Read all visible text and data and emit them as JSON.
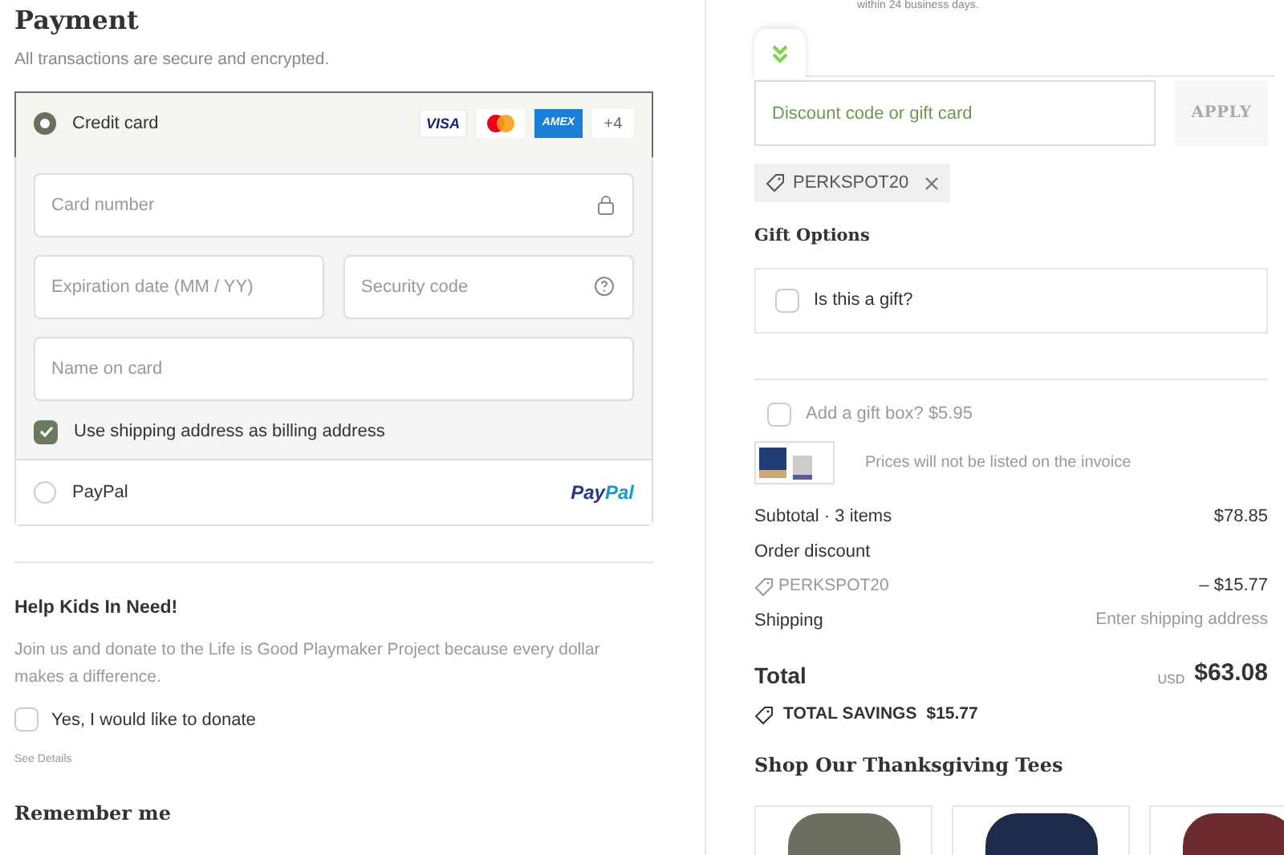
{
  "payment": {
    "title": "Payment",
    "subtitle": "All transactions are secure and encrypted.",
    "methods": [
      {
        "kind": "card",
        "label": "Credit card",
        "selected": true,
        "brands": [
          {
            "kind": "visa",
            "text": "VISA"
          },
          {
            "kind": "mastercard"
          },
          {
            "kind": "amex",
            "text": "AMEX"
          },
          {
            "kind": "more",
            "text": "+4"
          }
        ]
      },
      {
        "kind": "paypal",
        "label": "PayPal",
        "selected": false,
        "logo": [
          "Pay",
          "Pal"
        ]
      }
    ],
    "fields": {
      "card_number": {
        "placeholder": "Card number"
      },
      "expiry": {
        "placeholder": "Expiration date (MM / YY)"
      },
      "security": {
        "placeholder": "Security code"
      },
      "name": {
        "placeholder": "Name on card"
      }
    },
    "billing_same": {
      "label": "Use shipping address as billing address",
      "checked": true
    }
  },
  "donate": {
    "title": "Help Kids In Need!",
    "text": "Join us and donate to the Life is Good Playmaker Project because every dollar makes a difference.",
    "option": {
      "label": "Yes, I would like to donate",
      "checked": false
    },
    "link": "See Details"
  },
  "remember": {
    "title": "Remember me"
  },
  "summary": {
    "note": "within 24 business days.",
    "discount": {
      "placeholder": "Discount code or gift card",
      "button": "APPLY",
      "code": "PERKSPOT20"
    },
    "gift": {
      "title": "Gift Options",
      "option": {
        "label": "Is this a gift?",
        "checked": false
      },
      "box": {
        "label": "Add a gift box? $5.95",
        "checked": false
      },
      "note": "Prices will not be listed on the invoice"
    },
    "lines": [
      {
        "kind": "plain",
        "label": "Subtotal · 3 items",
        "value": "$78.85"
      },
      {
        "kind": "heading",
        "label": "Order discount"
      },
      {
        "kind": "code",
        "label": "PERKSPOT20",
        "value": "– $15.77"
      },
      {
        "kind": "muted",
        "label": "Shipping",
        "value": "Enter shipping address"
      }
    ],
    "total": {
      "label": "Total",
      "currency": "USD",
      "value": "$63.08"
    },
    "savings": {
      "label": "TOTAL SAVINGS",
      "value": "$15.77"
    },
    "shop": {
      "title": "Shop Our Thanksgiving Tees",
      "products": [
        {
          "color": "#6b6f5e"
        },
        {
          "color": "#1e2a4a"
        },
        {
          "color": "#6b2a2e"
        }
      ]
    }
  }
}
